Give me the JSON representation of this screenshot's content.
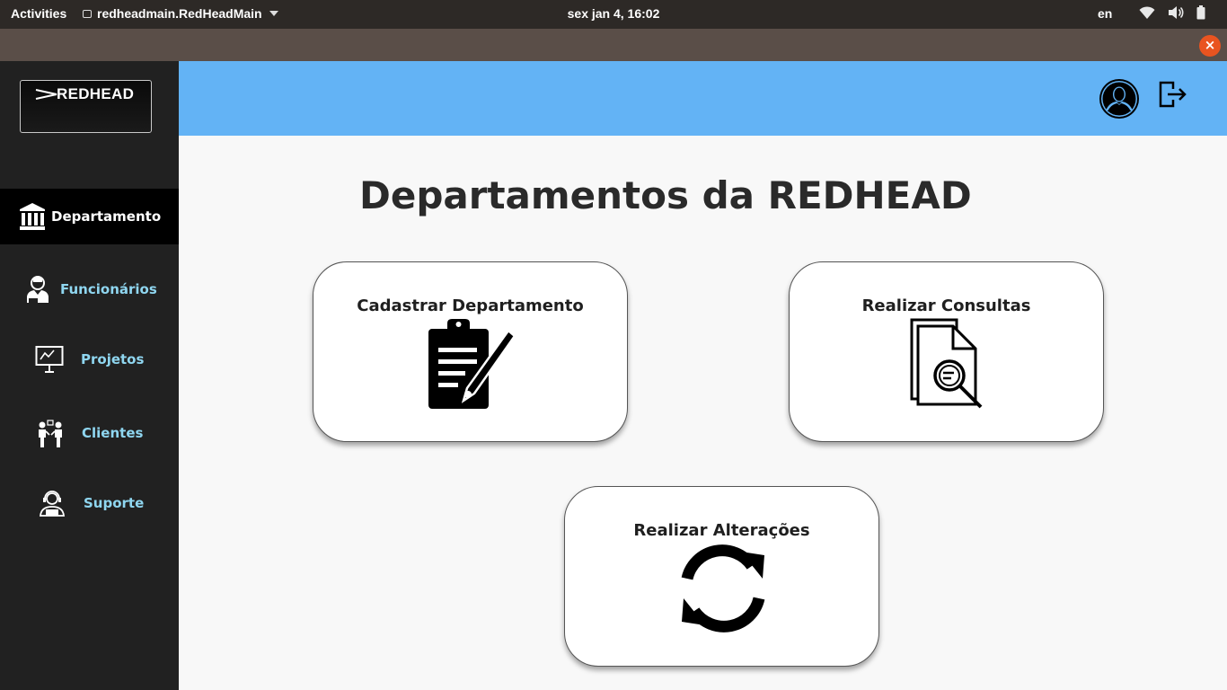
{
  "system_bar": {
    "activities": "Activities",
    "app_name": "redheadmain.RedHeadMain",
    "clock": "sex jan  4, 16:02",
    "language": "en"
  },
  "window": {
    "close_glyph": "×"
  },
  "logo": {
    "text": "REDHEAD"
  },
  "sidebar": {
    "items": [
      {
        "label": "Departamento",
        "icon": "bank-icon",
        "active": true
      },
      {
        "label": "Funcionários",
        "icon": "employee-icon",
        "active": false
      },
      {
        "label": "Projetos",
        "icon": "presentation-board-icon",
        "active": false
      },
      {
        "label": "Clientes",
        "icon": "meeting-people-icon",
        "active": false
      },
      {
        "label": "Suporte",
        "icon": "support-agent-icon",
        "active": false
      }
    ]
  },
  "header": {
    "avatar_icon": "user-avatar-icon",
    "logout_icon": "logout-icon"
  },
  "main": {
    "title": "Departamentos da REDHEAD",
    "cards": [
      {
        "label": "Cadastrar Departamento",
        "icon": "clipboard-pen-icon"
      },
      {
        "label": "Realizar Consultas",
        "icon": "document-search-icon"
      },
      {
        "label": "Realizar Alterações",
        "icon": "refresh-icon"
      }
    ]
  },
  "colors": {
    "sidebar_bg": "#212121",
    "header_bg": "#63b3f5",
    "nav_label": "#8fd6f0",
    "close_button": "#e95420"
  }
}
